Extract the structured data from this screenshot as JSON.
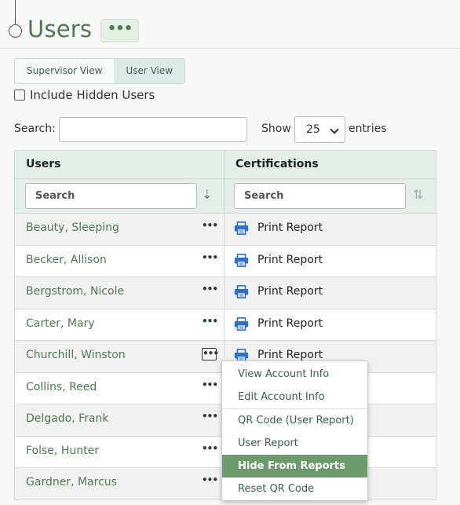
{
  "page": {
    "title": "Users",
    "more_label": "•••"
  },
  "view_toggle": {
    "supervisor": "Supervisor View",
    "user": "User View"
  },
  "include_hidden": {
    "label": "Include Hidden Users",
    "checked": false
  },
  "search": {
    "label": "Search:",
    "value": ""
  },
  "entries": {
    "show_label": "Show",
    "selected": "25",
    "suffix": "entries"
  },
  "table": {
    "headers": {
      "users": "Users",
      "certifications": "Certifications"
    },
    "filters": {
      "users_placeholder": "Search",
      "cert_placeholder": "Search"
    },
    "rows": [
      {
        "name": "Beauty, Sleeping",
        "action": "Print Report"
      },
      {
        "name": "Becker, Allison",
        "action": "Print Report"
      },
      {
        "name": "Bergstrom, Nicole",
        "action": "Print Report"
      },
      {
        "name": "Carter, Mary",
        "action": "Print Report"
      },
      {
        "name": "Churchill, Winston",
        "action": "Print Report"
      },
      {
        "name": "Collins, Reed",
        "action": ""
      },
      {
        "name": "Delgado, Frank",
        "action": ""
      },
      {
        "name": "Folse, Hunter",
        "action": ""
      },
      {
        "name": "Gardner, Marcus",
        "action": ""
      }
    ],
    "row_menu_label": "•••"
  },
  "context_menu": {
    "items": [
      "View Account Info",
      "Edit Account Info",
      "QR Code (User Report)",
      "User Report",
      "Hide From Reports",
      "Reset QR Code"
    ],
    "selected": "Hide From Reports"
  },
  "colors": {
    "accent": "#4f7a50",
    "menu_highlight": "#6c9a6c",
    "header_bg": "#e4ede8"
  }
}
